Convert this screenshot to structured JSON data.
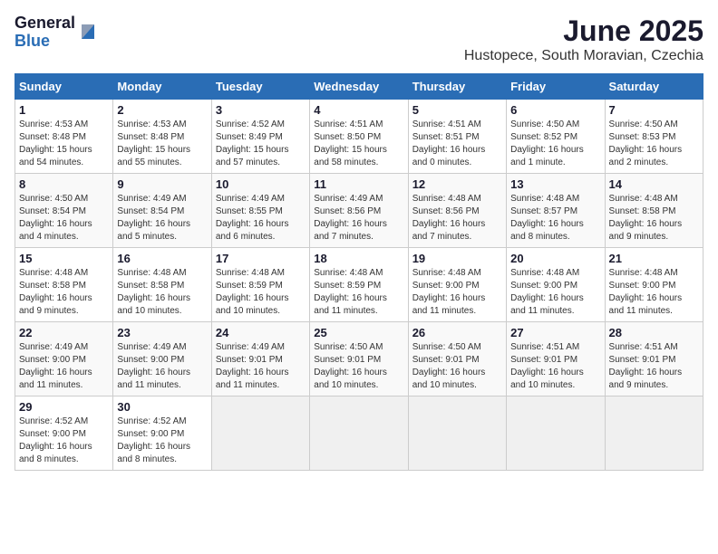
{
  "header": {
    "logo_general": "General",
    "logo_blue": "Blue",
    "month_title": "June 2025",
    "subtitle": "Hustopece, South Moravian, Czechia"
  },
  "weekdays": [
    "Sunday",
    "Monday",
    "Tuesday",
    "Wednesday",
    "Thursday",
    "Friday",
    "Saturday"
  ],
  "weeks": [
    [
      {
        "day": "1",
        "info": "Sunrise: 4:53 AM\nSunset: 8:48 PM\nDaylight: 15 hours\nand 54 minutes."
      },
      {
        "day": "2",
        "info": "Sunrise: 4:53 AM\nSunset: 8:48 PM\nDaylight: 15 hours\nand 55 minutes."
      },
      {
        "day": "3",
        "info": "Sunrise: 4:52 AM\nSunset: 8:49 PM\nDaylight: 15 hours\nand 57 minutes."
      },
      {
        "day": "4",
        "info": "Sunrise: 4:51 AM\nSunset: 8:50 PM\nDaylight: 15 hours\nand 58 minutes."
      },
      {
        "day": "5",
        "info": "Sunrise: 4:51 AM\nSunset: 8:51 PM\nDaylight: 16 hours\nand 0 minutes."
      },
      {
        "day": "6",
        "info": "Sunrise: 4:50 AM\nSunset: 8:52 PM\nDaylight: 16 hours\nand 1 minute."
      },
      {
        "day": "7",
        "info": "Sunrise: 4:50 AM\nSunset: 8:53 PM\nDaylight: 16 hours\nand 2 minutes."
      }
    ],
    [
      {
        "day": "8",
        "info": "Sunrise: 4:50 AM\nSunset: 8:54 PM\nDaylight: 16 hours\nand 4 minutes."
      },
      {
        "day": "9",
        "info": "Sunrise: 4:49 AM\nSunset: 8:54 PM\nDaylight: 16 hours\nand 5 minutes."
      },
      {
        "day": "10",
        "info": "Sunrise: 4:49 AM\nSunset: 8:55 PM\nDaylight: 16 hours\nand 6 minutes."
      },
      {
        "day": "11",
        "info": "Sunrise: 4:49 AM\nSunset: 8:56 PM\nDaylight: 16 hours\nand 7 minutes."
      },
      {
        "day": "12",
        "info": "Sunrise: 4:48 AM\nSunset: 8:56 PM\nDaylight: 16 hours\nand 7 minutes."
      },
      {
        "day": "13",
        "info": "Sunrise: 4:48 AM\nSunset: 8:57 PM\nDaylight: 16 hours\nand 8 minutes."
      },
      {
        "day": "14",
        "info": "Sunrise: 4:48 AM\nSunset: 8:58 PM\nDaylight: 16 hours\nand 9 minutes."
      }
    ],
    [
      {
        "day": "15",
        "info": "Sunrise: 4:48 AM\nSunset: 8:58 PM\nDaylight: 16 hours\nand 9 minutes."
      },
      {
        "day": "16",
        "info": "Sunrise: 4:48 AM\nSunset: 8:58 PM\nDaylight: 16 hours\nand 10 minutes."
      },
      {
        "day": "17",
        "info": "Sunrise: 4:48 AM\nSunset: 8:59 PM\nDaylight: 16 hours\nand 10 minutes."
      },
      {
        "day": "18",
        "info": "Sunrise: 4:48 AM\nSunset: 8:59 PM\nDaylight: 16 hours\nand 11 minutes."
      },
      {
        "day": "19",
        "info": "Sunrise: 4:48 AM\nSunset: 9:00 PM\nDaylight: 16 hours\nand 11 minutes."
      },
      {
        "day": "20",
        "info": "Sunrise: 4:48 AM\nSunset: 9:00 PM\nDaylight: 16 hours\nand 11 minutes."
      },
      {
        "day": "21",
        "info": "Sunrise: 4:48 AM\nSunset: 9:00 PM\nDaylight: 16 hours\nand 11 minutes."
      }
    ],
    [
      {
        "day": "22",
        "info": "Sunrise: 4:49 AM\nSunset: 9:00 PM\nDaylight: 16 hours\nand 11 minutes."
      },
      {
        "day": "23",
        "info": "Sunrise: 4:49 AM\nSunset: 9:00 PM\nDaylight: 16 hours\nand 11 minutes."
      },
      {
        "day": "24",
        "info": "Sunrise: 4:49 AM\nSunset: 9:01 PM\nDaylight: 16 hours\nand 11 minutes."
      },
      {
        "day": "25",
        "info": "Sunrise: 4:50 AM\nSunset: 9:01 PM\nDaylight: 16 hours\nand 10 minutes."
      },
      {
        "day": "26",
        "info": "Sunrise: 4:50 AM\nSunset: 9:01 PM\nDaylight: 16 hours\nand 10 minutes."
      },
      {
        "day": "27",
        "info": "Sunrise: 4:51 AM\nSunset: 9:01 PM\nDaylight: 16 hours\nand 10 minutes."
      },
      {
        "day": "28",
        "info": "Sunrise: 4:51 AM\nSunset: 9:01 PM\nDaylight: 16 hours\nand 9 minutes."
      }
    ],
    [
      {
        "day": "29",
        "info": "Sunrise: 4:52 AM\nSunset: 9:00 PM\nDaylight: 16 hours\nand 8 minutes."
      },
      {
        "day": "30",
        "info": "Sunrise: 4:52 AM\nSunset: 9:00 PM\nDaylight: 16 hours\nand 8 minutes."
      },
      {
        "day": "",
        "info": ""
      },
      {
        "day": "",
        "info": ""
      },
      {
        "day": "",
        "info": ""
      },
      {
        "day": "",
        "info": ""
      },
      {
        "day": "",
        "info": ""
      }
    ]
  ]
}
